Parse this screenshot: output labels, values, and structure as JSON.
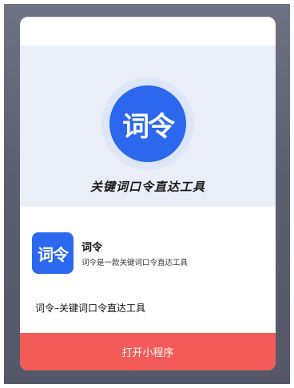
{
  "hero": {
    "logo_text": "词令",
    "title": "关键词口令直达工具"
  },
  "app": {
    "icon_text": "词令",
    "name": "词令",
    "description": "词令是一款关键词口令直达工具"
  },
  "subtitle": "词令–关键词口令直达工具",
  "open_button_label": "打开小程序",
  "colors": {
    "brand_blue": "#2b68ee",
    "button_red": "#f25b57",
    "hero_bg": "#e9eef8"
  }
}
